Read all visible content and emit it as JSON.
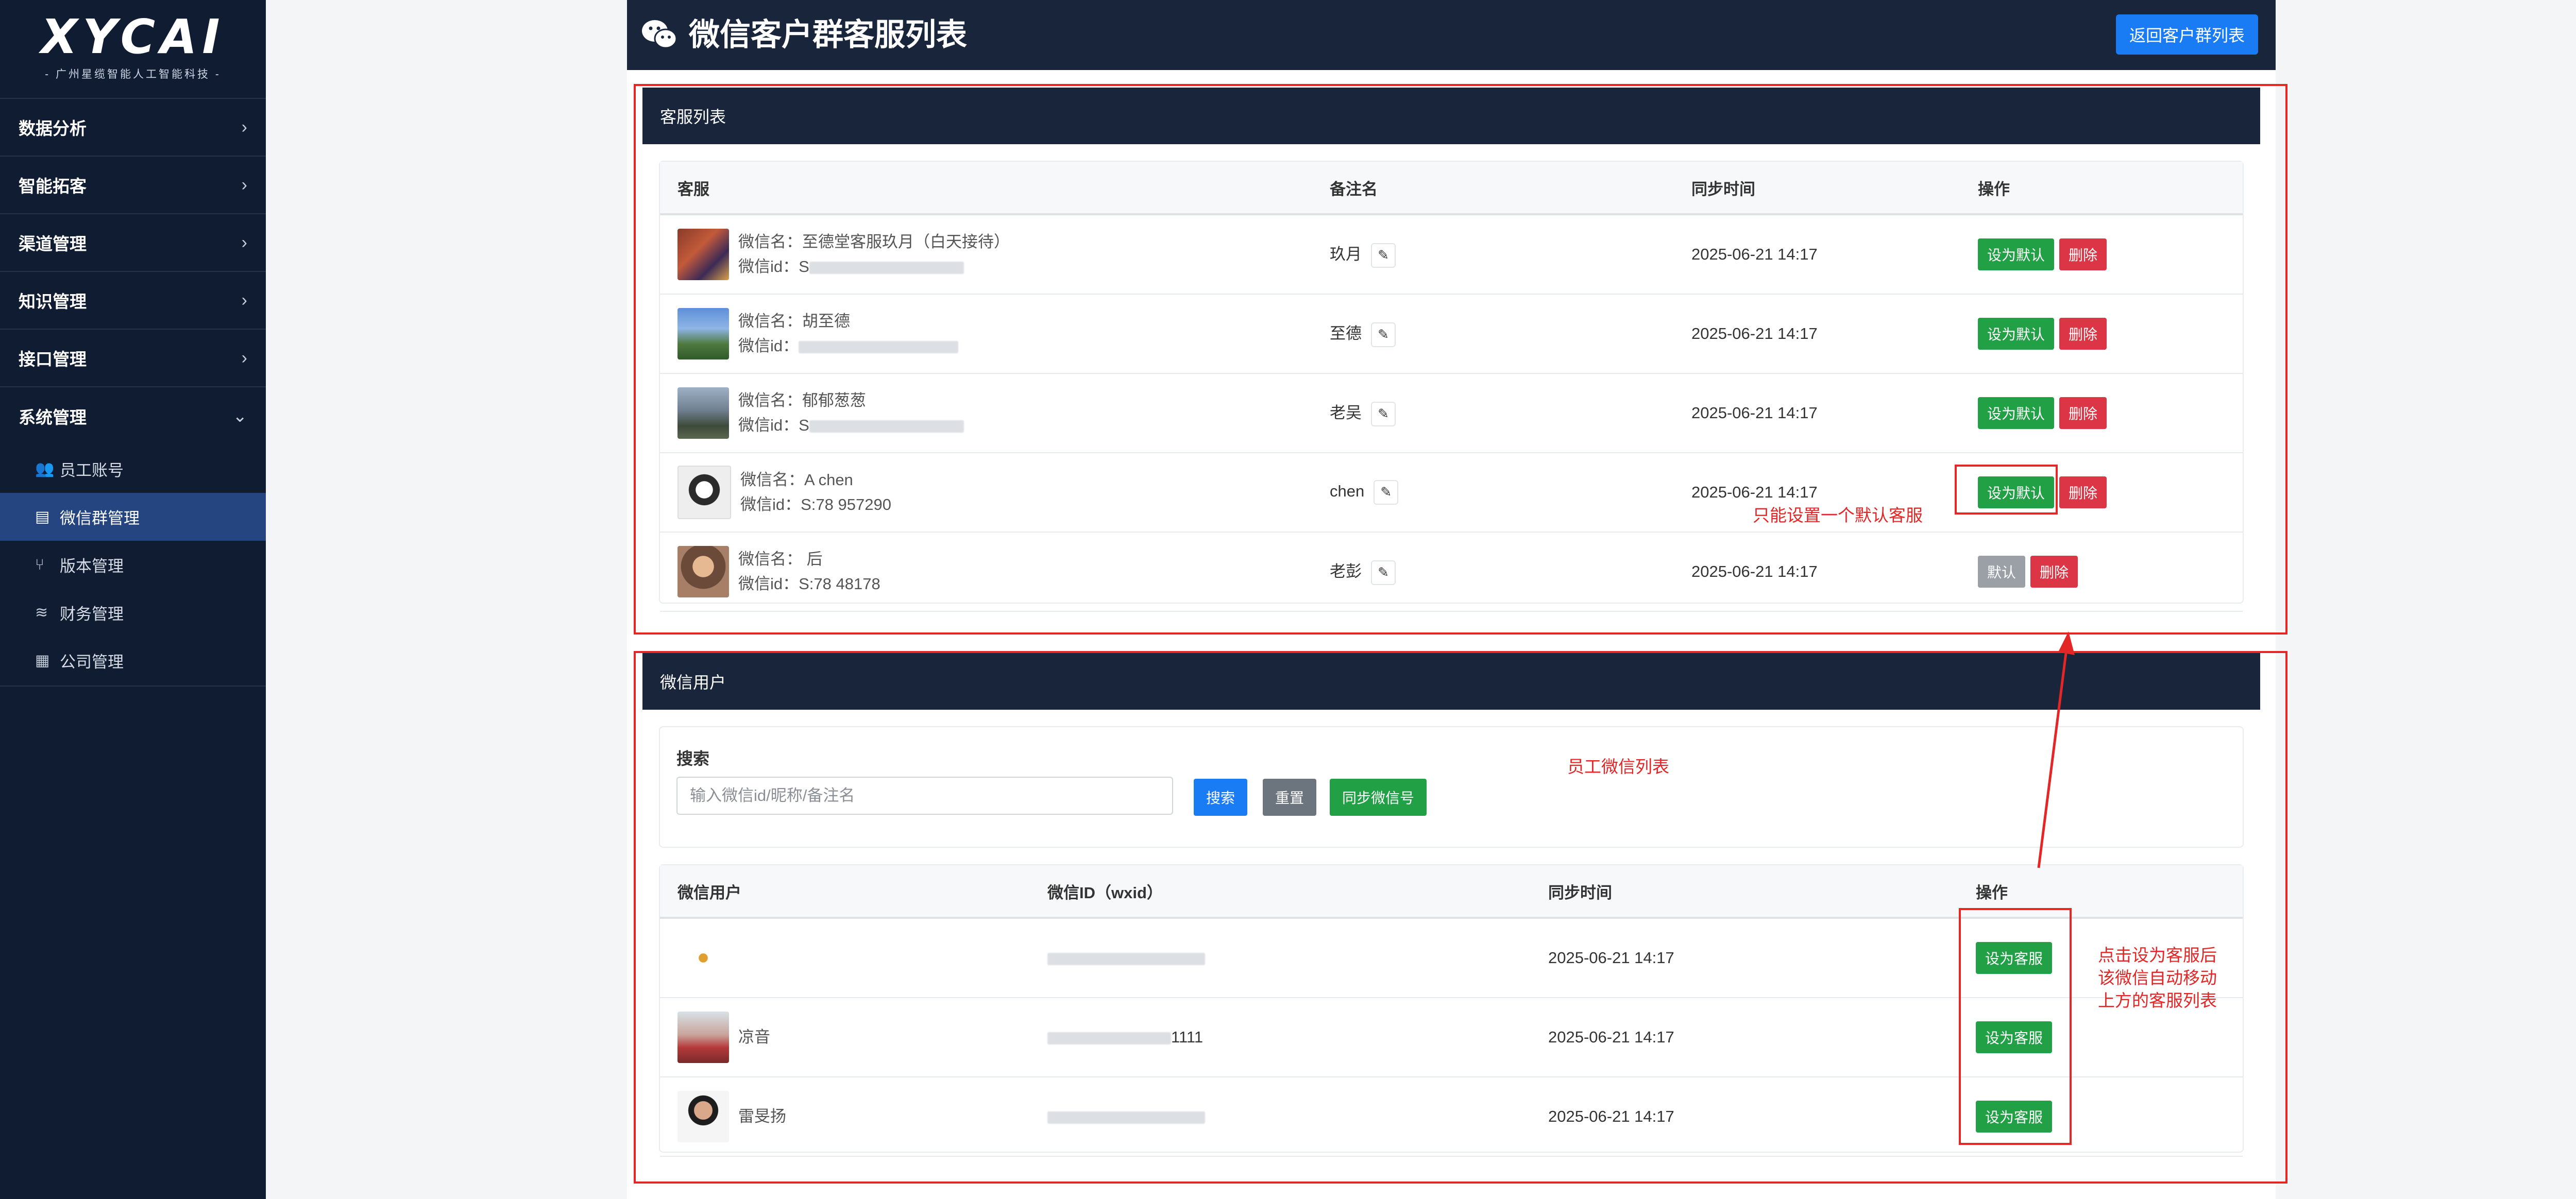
{
  "sidebar": {
    "logo_text": "XYCAI",
    "logo_sub": "- 广州星缆智能人工智能科技 -",
    "items": [
      {
        "label": "数据分析",
        "arrow": "›"
      },
      {
        "label": "智能拓客",
        "arrow": "›"
      },
      {
        "label": "渠道管理",
        "arrow": "›"
      },
      {
        "label": "知识管理",
        "arrow": "›"
      },
      {
        "label": "接口管理",
        "arrow": "›"
      },
      {
        "label": "系统管理",
        "arrow": "⌄"
      }
    ],
    "subitems": [
      {
        "label": "员工账号"
      },
      {
        "label": "微信群管理"
      },
      {
        "label": "版本管理"
      },
      {
        "label": "财务管理"
      },
      {
        "label": "公司管理"
      }
    ]
  },
  "header": {
    "title": "微信客户群客服列表",
    "back_label": "返回客户群列表"
  },
  "service_section": {
    "title": "客服列表",
    "columns": [
      "客服",
      "备注名",
      "同步时间",
      "操作"
    ],
    "rows": [
      {
        "name": "微信名：至德堂客服玖月（白天接待）",
        "id": "微信id：S",
        "remark": "玖月",
        "time": "2025-06-21 14:17",
        "action": "设为默认",
        "delete": "删除"
      },
      {
        "name": "微信名：胡至德",
        "id": "微信id：",
        "remark": "至德",
        "time": "2025-06-21 14:17",
        "action": "设为默认",
        "delete": "删除"
      },
      {
        "name": "微信名：郁郁葱葱",
        "id": "微信id：S",
        "remark": "老吴",
        "time": "2025-06-21 14:17",
        "action": "设为默认",
        "delete": "删除"
      },
      {
        "name": "微信名：A chen",
        "id": "微信id：S:78 957290",
        "remark": "chen",
        "time": "2025-06-21 14:17",
        "action": "设为默认",
        "delete": "删除"
      },
      {
        "name": "微信名： 后",
        "id": "微信id：S:78 48178",
        "remark": "老彭",
        "time": "2025-06-21 14:17",
        "action": "默认",
        "delete": "删除"
      }
    ]
  },
  "user_section": {
    "title": "微信用户",
    "search_label": "搜索",
    "search_placeholder": "输入微信id/昵称/备注名",
    "search_btn": "搜索",
    "reset_btn": "重置",
    "sync_btn": "同步微信号",
    "columns": [
      "微信用户",
      "微信ID（wxid）",
      "同步时间",
      "操作"
    ],
    "rows": [
      {
        "name": "",
        "wxid": "",
        "time": "2025-06-21 14:17",
        "action": "设为客服"
      },
      {
        "name": "凉音",
        "wxid": "1111",
        "time": "2025-06-21 14:17",
        "action": "设为客服"
      },
      {
        "name": "雷旻扬",
        "wxid": "",
        "time": "2025-06-21 14:17",
        "action": "设为客服"
      }
    ]
  },
  "annotations": {
    "default_note": "只能设置一个默认客服",
    "staff_note": "员工微信列表",
    "move_note_1": "点击设为客服后",
    "move_note_2": "该微信自动移动",
    "move_note_3": "上方的客服列表"
  },
  "colors": {
    "sidebar_bg": "#0f1c31",
    "header_bg": "#19253b",
    "primary": "#1a7cf5",
    "success": "#22a046",
    "danger": "#dc3545",
    "annotation": "#e32626"
  }
}
